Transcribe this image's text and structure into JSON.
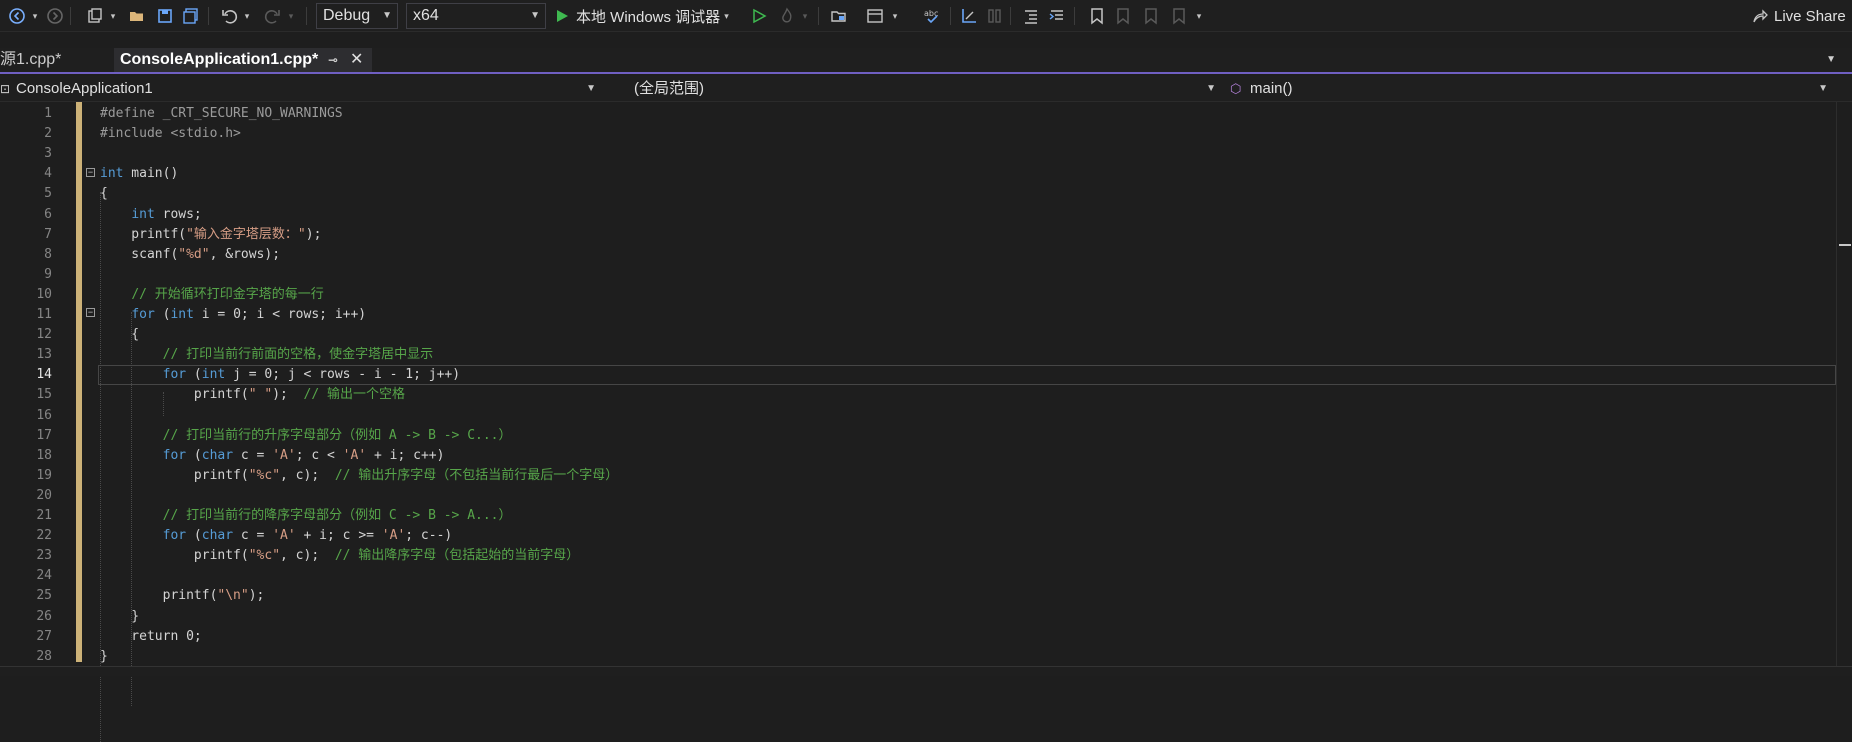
{
  "toolbar": {
    "config": "Debug",
    "platform": "x64",
    "run_label": "本地 Windows 调试器",
    "live_share": "Live Share"
  },
  "tabs": [
    {
      "label": "源1.cpp*"
    },
    {
      "label": "ConsoleApplication1.cpp*"
    }
  ],
  "nav": {
    "project": "ConsoleApplication1",
    "scope": "(全局范围)",
    "member": "main()"
  },
  "editor": {
    "current_line": 14,
    "lines": [
      [
        {
          "t": "#define _CRT_SECURE_NO_WARNINGS",
          "c": "pp"
        }
      ],
      [
        {
          "t": "#include <stdio.h>",
          "c": "pp"
        }
      ],
      [],
      [
        {
          "t": "int",
          "c": "kw"
        },
        {
          "t": " main()",
          "c": ""
        }
      ],
      [
        {
          "t": "{",
          "c": ""
        }
      ],
      [
        {
          "t": "    ",
          "c": ""
        },
        {
          "t": "int",
          "c": "kw"
        },
        {
          "t": " rows;",
          "c": ""
        }
      ],
      [
        {
          "t": "    printf(",
          "c": ""
        },
        {
          "t": "\"输入金字塔层数：\"",
          "c": "str"
        },
        {
          "t": ");",
          "c": ""
        }
      ],
      [
        {
          "t": "    scanf(",
          "c": ""
        },
        {
          "t": "\"%d\"",
          "c": "str"
        },
        {
          "t": ", &rows);",
          "c": ""
        }
      ],
      [],
      [
        {
          "t": "    ",
          "c": ""
        },
        {
          "t": "// 开始循环打印金字塔的每一行",
          "c": "cm"
        }
      ],
      [
        {
          "t": "    ",
          "c": ""
        },
        {
          "t": "for",
          "c": "kw"
        },
        {
          "t": " (",
          "c": ""
        },
        {
          "t": "int",
          "c": "kw"
        },
        {
          "t": " i = 0; i < rows; i++)",
          "c": ""
        }
      ],
      [
        {
          "t": "    {",
          "c": ""
        }
      ],
      [
        {
          "t": "        ",
          "c": ""
        },
        {
          "t": "// 打印当前行前面的空格，使金字塔居中显示",
          "c": "cm"
        }
      ],
      [
        {
          "t": "        ",
          "c": ""
        },
        {
          "t": "for",
          "c": "kw"
        },
        {
          "t": " (",
          "c": ""
        },
        {
          "t": "int",
          "c": "kw"
        },
        {
          "t": " j = 0; j < rows - i - 1; j++)",
          "c": ""
        }
      ],
      [
        {
          "t": "            printf(",
          "c": ""
        },
        {
          "t": "\" \"",
          "c": "str"
        },
        {
          "t": ");  ",
          "c": ""
        },
        {
          "t": "// 输出一个空格",
          "c": "cm"
        }
      ],
      [],
      [
        {
          "t": "        ",
          "c": ""
        },
        {
          "t": "// 打印当前行的升序字母部分（例如 A -> B -> C...）",
          "c": "cm"
        }
      ],
      [
        {
          "t": "        ",
          "c": ""
        },
        {
          "t": "for",
          "c": "kw"
        },
        {
          "t": " (",
          "c": ""
        },
        {
          "t": "char",
          "c": "kw"
        },
        {
          "t": " c = ",
          "c": ""
        },
        {
          "t": "'A'",
          "c": "str"
        },
        {
          "t": "; c < ",
          "c": ""
        },
        {
          "t": "'A'",
          "c": "str"
        },
        {
          "t": " + i; c++)",
          "c": ""
        }
      ],
      [
        {
          "t": "            printf(",
          "c": ""
        },
        {
          "t": "\"%c\"",
          "c": "str"
        },
        {
          "t": ", c);  ",
          "c": ""
        },
        {
          "t": "// 输出升序字母（不包括当前行最后一个字母）",
          "c": "cm"
        }
      ],
      [],
      [
        {
          "t": "        ",
          "c": ""
        },
        {
          "t": "// 打印当前行的降序字母部分（例如 C -> B -> A...）",
          "c": "cm"
        }
      ],
      [
        {
          "t": "        ",
          "c": ""
        },
        {
          "t": "for",
          "c": "kw"
        },
        {
          "t": " (",
          "c": ""
        },
        {
          "t": "char",
          "c": "kw"
        },
        {
          "t": " c = ",
          "c": ""
        },
        {
          "t": "'A'",
          "c": "str"
        },
        {
          "t": " + i; c >= ",
          "c": ""
        },
        {
          "t": "'A'",
          "c": "str"
        },
        {
          "t": "; c--)",
          "c": ""
        }
      ],
      [
        {
          "t": "            printf(",
          "c": ""
        },
        {
          "t": "\"%c\"",
          "c": "str"
        },
        {
          "t": ", c);  ",
          "c": ""
        },
        {
          "t": "// 输出降序字母（包括起始的当前字母）",
          "c": "cm"
        }
      ],
      [],
      [
        {
          "t": "        printf(",
          "c": ""
        },
        {
          "t": "\"\\n\"",
          "c": "str"
        },
        {
          "t": ");",
          "c": ""
        }
      ],
      [
        {
          "t": "    }",
          "c": ""
        }
      ],
      [
        {
          "t": "    return 0;",
          "c": ""
        }
      ],
      [
        {
          "t": "}",
          "c": ""
        }
      ]
    ]
  },
  "colors": {
    "accent": "#6f5fc2",
    "keyword": "#569cd6",
    "string": "#d69d85",
    "comment": "#57a64a",
    "preprocessor": "#9b9b9b",
    "change_bar": "#d7ba7d"
  }
}
